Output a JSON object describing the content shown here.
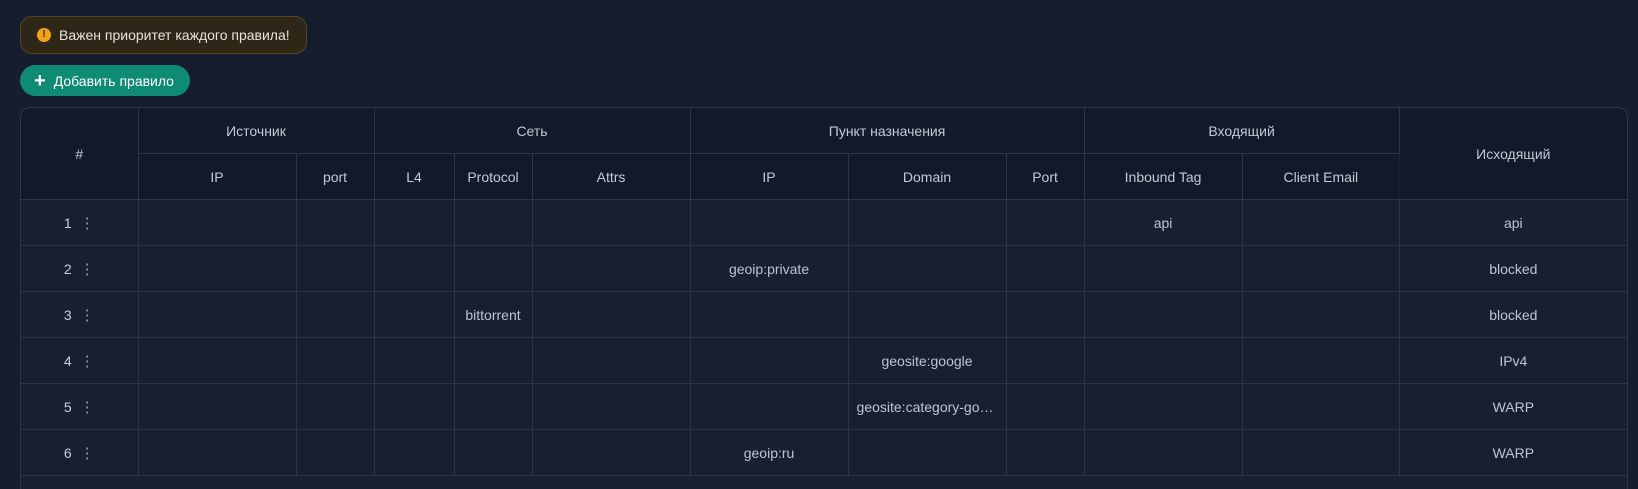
{
  "alert": {
    "text": "Важен приоритет каждого правила!",
    "icon": "warning-icon",
    "color": "#f0a21a"
  },
  "add_button": {
    "label": "Добавить правило",
    "icon": "plus-icon",
    "color": "#0f8a73"
  },
  "table": {
    "groups": {
      "number": "#",
      "source": "Источник",
      "network": "Сеть",
      "destination": "Пункт назначения",
      "inbound": "Входящий",
      "outbound": "Исходящий"
    },
    "columns": {
      "source_ip": "IP",
      "source_port": "port",
      "l4": "L4",
      "protocol": "Protocol",
      "attrs": "Attrs",
      "dest_ip": "IP",
      "domain": "Domain",
      "dest_port": "Port",
      "inbound_tag": "Inbound Tag",
      "client_email": "Client Email"
    },
    "rows": [
      {
        "num": "1",
        "source_ip": "",
        "source_port": "",
        "l4": "",
        "protocol": "",
        "attrs": "",
        "dest_ip": "",
        "domain": "",
        "dest_port": "",
        "inbound_tag": "api",
        "client_email": "",
        "outbound": "api"
      },
      {
        "num": "2",
        "source_ip": "",
        "source_port": "",
        "l4": "",
        "protocol": "",
        "attrs": "",
        "dest_ip": "geoip:private",
        "domain": "",
        "dest_port": "",
        "inbound_tag": "",
        "client_email": "",
        "outbound": "blocked"
      },
      {
        "num": "3",
        "source_ip": "",
        "source_port": "",
        "l4": "",
        "protocol": "bittorrent",
        "attrs": "",
        "dest_ip": "",
        "domain": "",
        "dest_port": "",
        "inbound_tag": "",
        "client_email": "",
        "outbound": "blocked"
      },
      {
        "num": "4",
        "source_ip": "",
        "source_port": "",
        "l4": "",
        "protocol": "",
        "attrs": "",
        "dest_ip": "",
        "domain": "geosite:google",
        "dest_port": "",
        "inbound_tag": "",
        "client_email": "",
        "outbound": "IPv4"
      },
      {
        "num": "5",
        "source_ip": "",
        "source_port": "",
        "l4": "",
        "protocol": "",
        "attrs": "",
        "dest_ip": "",
        "domain": "geosite:category-gov…",
        "dest_port": "",
        "inbound_tag": "",
        "client_email": "",
        "outbound": "WARP"
      },
      {
        "num": "6",
        "source_ip": "",
        "source_port": "",
        "l4": "",
        "protocol": "",
        "attrs": "",
        "dest_ip": "geoip:ru",
        "domain": "",
        "dest_port": "",
        "inbound_tag": "",
        "client_email": "",
        "outbound": "WARP"
      }
    ],
    "row_menu_icon": "more-vertical-icon"
  }
}
